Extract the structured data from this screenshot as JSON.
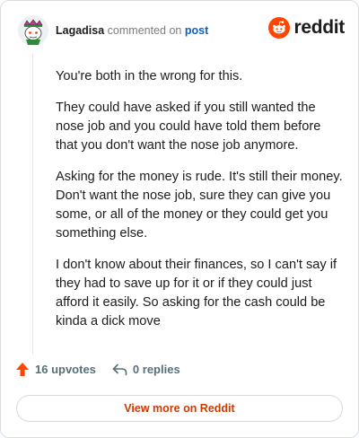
{
  "header": {
    "username": "Lagadisa",
    "action_text": "commented on",
    "post_link": "post"
  },
  "brand": {
    "logo_icon": "reddit-alien-icon",
    "name": "reddit",
    "color": "#ff4500"
  },
  "comment": {
    "paragraphs": [
      "You're both in the wrong for this.",
      "They could have asked if you still wanted the nose job and you could have told them before that you don't want the nose job anymore.",
      "Asking for the money is rude. It's still their money. Don't want the nose job, sure they can give you some, or all of the money or they could get you something else.",
      "I don't know about their finances, so I can't say if they had to save up for it or if they could just afford it easily. So asking for the cash could be kinda a dick move"
    ]
  },
  "actions": {
    "upvote_icon": "upvote-arrow-icon",
    "upvotes_label": "16 upvotes",
    "reply_icon": "reply-arrow-icon",
    "replies_label": "0 replies"
  },
  "footer": {
    "view_more_label": "View more on Reddit"
  },
  "colors": {
    "accent": "#ff4500",
    "link": "#0f5fbf",
    "view_more": "#cc3a00"
  }
}
